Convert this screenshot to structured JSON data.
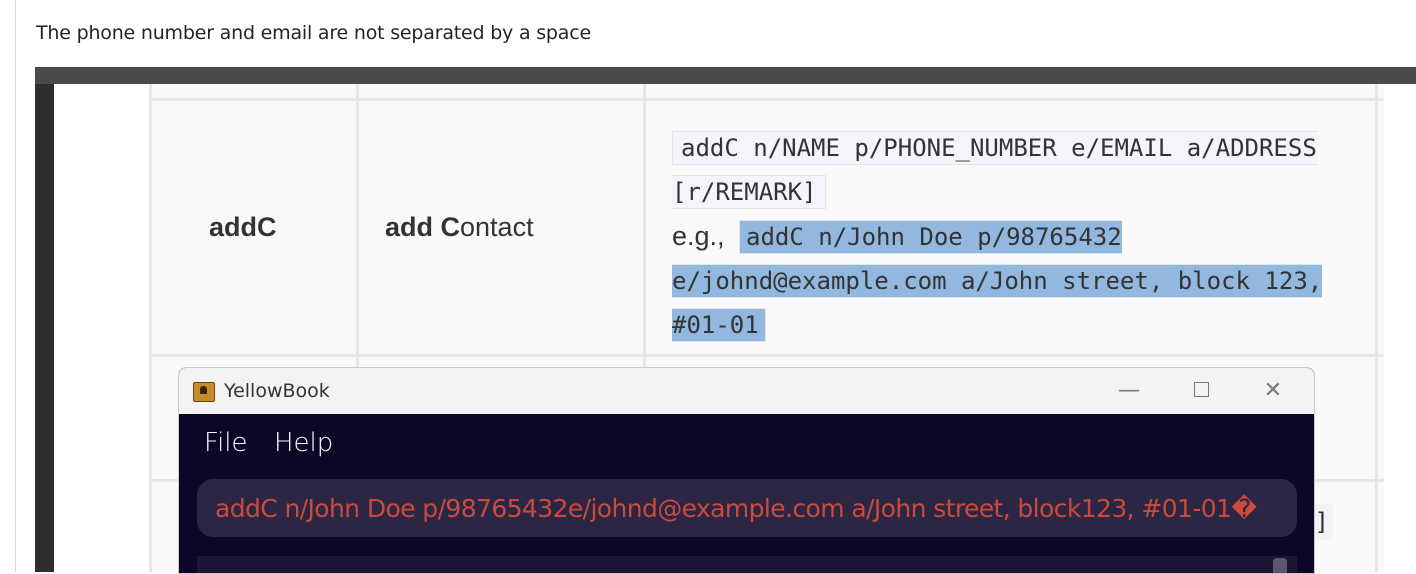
{
  "issue": {
    "description": "The phone number and email are not separated by a space"
  },
  "guide_table": {
    "command": "addC",
    "action_bold": "add C",
    "action_rest": "ontact",
    "format": "addC n/NAME p/PHONE_NUMBER e/EMAIL a/ADDRESS [r/REMARK]",
    "example_label": "e.g.,",
    "example": "addC n/John Doe p/98765432 e/johnd@example.com a/John street, block 123, #01-01",
    "cut_off_fragment": "]"
  },
  "app_window": {
    "title": "YellowBook",
    "icon": "app-book-icon",
    "controls": {
      "minimize": "—",
      "maximize": "maximize-icon",
      "close": "✕"
    },
    "menu": [
      "File",
      "Help"
    ],
    "command_input_value": "addC n/John Doe p/98765432e/johnd@example.com a/John street, block123, #01-01�"
  },
  "colors": {
    "window_background": "#0d0627",
    "command_box": "#2a2643",
    "command_text": "#cc4a3c",
    "highlight": "#93b8df"
  }
}
